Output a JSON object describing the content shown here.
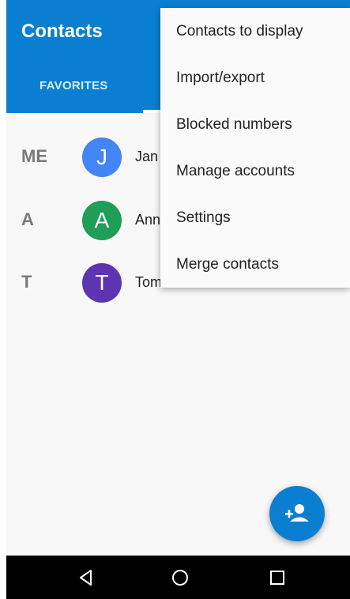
{
  "appbar": {
    "title": "Contacts",
    "tabs": [
      {
        "label": "FAVORITES"
      }
    ]
  },
  "contacts": [
    {
      "section": "ME",
      "initial": "J",
      "name": "Jan",
      "color": "#4285f4"
    },
    {
      "section": "A",
      "initial": "A",
      "name": "Ann",
      "color": "#1e9e57"
    },
    {
      "section": "T",
      "initial": "T",
      "name": "Tom",
      "color": "#5e35b1"
    }
  ],
  "menu": {
    "items": [
      {
        "label": "Contacts to display"
      },
      {
        "label": "Import/export"
      },
      {
        "label": "Blocked numbers"
      },
      {
        "label": "Manage accounts"
      },
      {
        "label": "Settings"
      },
      {
        "label": "Merge contacts"
      }
    ]
  },
  "fab": {
    "icon": "add-person-icon",
    "color": "#0a7fd1"
  },
  "navbar": {
    "icons": [
      "back-icon",
      "home-icon",
      "recents-icon"
    ]
  },
  "colors": {
    "primary": "#0a7fd1",
    "background": "#f8f8f8"
  }
}
